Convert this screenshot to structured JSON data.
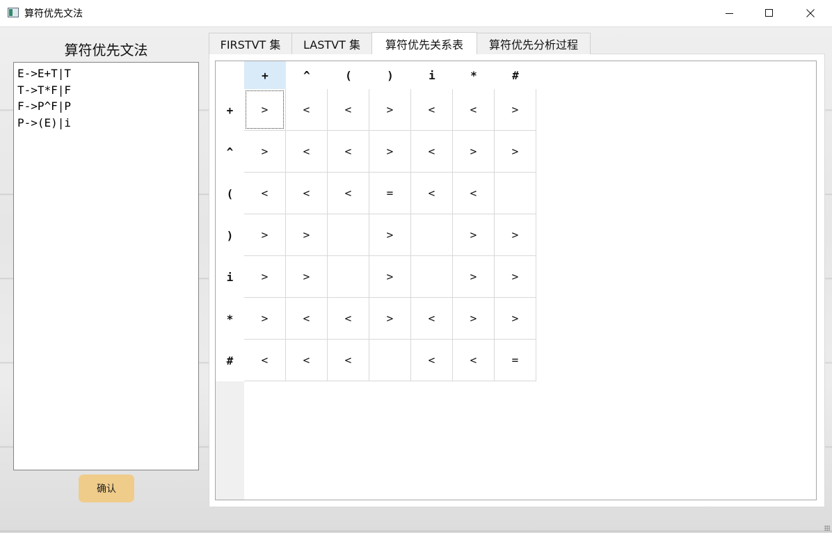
{
  "window": {
    "title": "算符优先文法"
  },
  "window_controls": {
    "minimize": "minimize",
    "maximize": "maximize",
    "close": "close"
  },
  "left_panel": {
    "title": "算符优先文法",
    "grammar_lines": [
      "E->E+T|T",
      "T->T*F|F",
      "F->P^F|P",
      "P->(E)|i"
    ],
    "confirm_label": "确认",
    "confirm_color": "#f0cc8a"
  },
  "tabs": [
    {
      "label": "FIRSTVT 集",
      "active": false
    },
    {
      "label": "LASTVT 集",
      "active": false
    },
    {
      "label": "算符优先关系表",
      "active": true
    },
    {
      "label": "算符优先分析过程",
      "active": false
    }
  ],
  "relation_table": {
    "columns": [
      "+",
      "^",
      "(",
      ")",
      "i",
      "*",
      "#"
    ],
    "rows": [
      "+",
      "^",
      "(",
      ")",
      "i",
      "*",
      "#"
    ],
    "cells": [
      [
        ">",
        "<",
        "<",
        ">",
        "<",
        "<",
        ">"
      ],
      [
        ">",
        "<",
        "<",
        ">",
        "<",
        ">",
        ">"
      ],
      [
        "<",
        "<",
        "<",
        "=",
        "<",
        "<",
        ""
      ],
      [
        ">",
        ">",
        "",
        ">",
        "",
        ">",
        ">"
      ],
      [
        ">",
        ">",
        "",
        ">",
        "",
        ">",
        ">"
      ],
      [
        ">",
        "<",
        "<",
        ">",
        "<",
        ">",
        ">"
      ],
      [
        "<",
        "<",
        "<",
        "",
        "<",
        "<",
        "="
      ]
    ],
    "selected_column": 0,
    "focused_cell": [
      0,
      0
    ],
    "selection_color": "#d9ebf9"
  }
}
